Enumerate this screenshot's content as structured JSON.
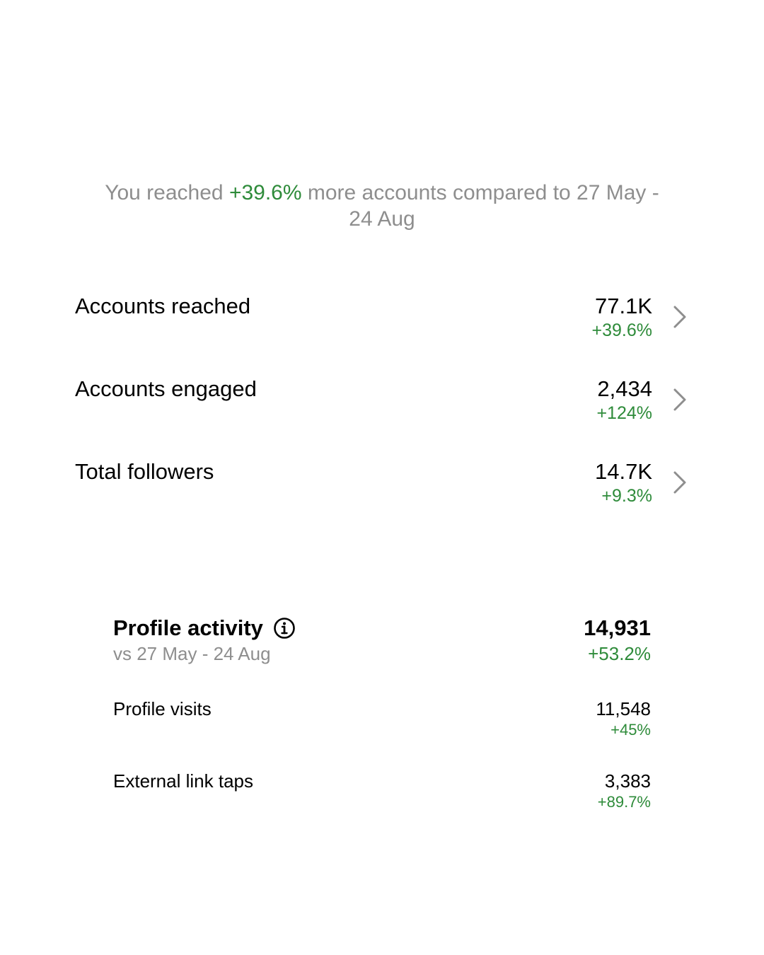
{
  "colors": {
    "positive": "#2e8b3a",
    "muted": "#8e8e8e",
    "text": "#000000",
    "background": "#ffffff"
  },
  "summary": {
    "prefix": "You reached ",
    "highlight": "+39.6%",
    "suffix": " more accounts compared to 27 May - 24 Aug"
  },
  "metrics": [
    {
      "label": "Accounts reached",
      "value": "77.1K",
      "change": "+39.6%",
      "icon": "chevron-right-icon"
    },
    {
      "label": "Accounts engaged",
      "value": "2,434",
      "change": "+124%",
      "icon": "chevron-right-icon"
    },
    {
      "label": "Total followers",
      "value": "14.7K",
      "change": "+9.3%",
      "icon": "chevron-right-icon"
    }
  ],
  "profile_activity": {
    "title": "Profile activity",
    "icon": "info-icon",
    "subtitle": "vs 27 May - 24 Aug",
    "total": "14,931",
    "change": "+53.2%",
    "items": [
      {
        "label": "Profile visits",
        "value": "11,548",
        "change": "+45%"
      },
      {
        "label": "External link taps",
        "value": "3,383",
        "change": "+89.7%"
      }
    ]
  }
}
